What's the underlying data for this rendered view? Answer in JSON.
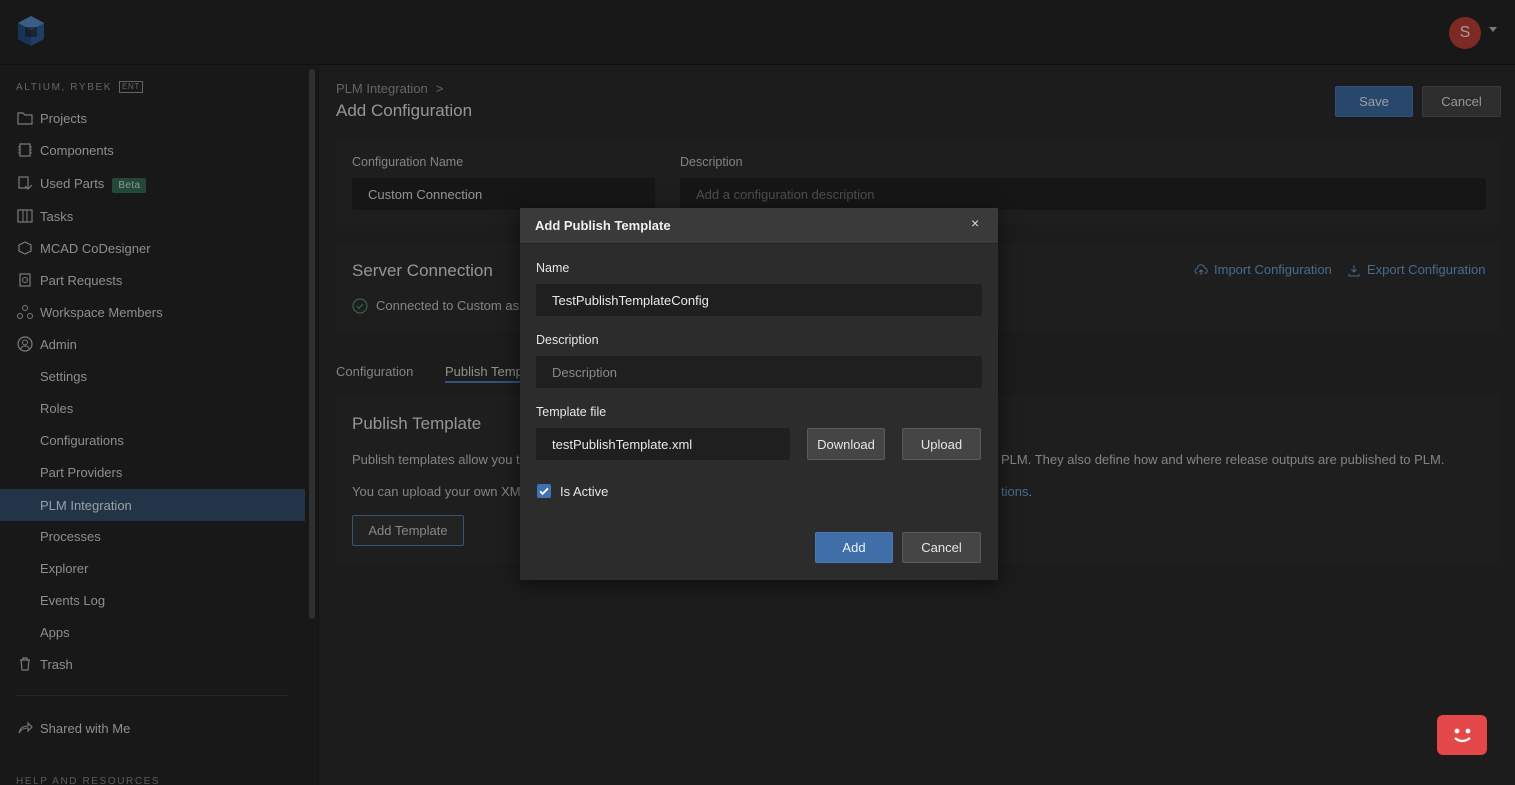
{
  "header": {
    "avatar_initial": "S"
  },
  "sidebar": {
    "workspace": "ALTIUM, RYBEK",
    "workspace_badge": "ENT",
    "items": [
      {
        "label": "Projects",
        "icon": "folder-icon"
      },
      {
        "label": "Components",
        "icon": "chip-icon"
      },
      {
        "label": "Used Parts",
        "icon": "used-parts-icon",
        "badge": "Beta"
      },
      {
        "label": "Tasks",
        "icon": "board-icon"
      },
      {
        "label": "MCAD CoDesigner",
        "icon": "cube-icon"
      },
      {
        "label": "Part Requests",
        "icon": "request-icon"
      },
      {
        "label": "Workspace Members",
        "icon": "members-icon"
      },
      {
        "label": "Admin",
        "icon": "user-circle-icon"
      },
      {
        "label": "Settings"
      },
      {
        "label": "Roles"
      },
      {
        "label": "Configurations"
      },
      {
        "label": "Part Providers"
      },
      {
        "label": "PLM Integration",
        "active": true
      },
      {
        "label": "Processes"
      },
      {
        "label": "Explorer"
      },
      {
        "label": "Events Log"
      },
      {
        "label": "Apps"
      },
      {
        "label": "Trash",
        "icon": "trash-icon"
      }
    ],
    "shared": {
      "label": "Shared with Me",
      "icon": "share-icon"
    },
    "help_heading": "HELP AND RESOURCES",
    "active_color": "#35506f"
  },
  "main": {
    "breadcrumb": "PLM Integration",
    "breadcrumb_sep": ">",
    "title": "Add Configuration",
    "save_label": "Save",
    "cancel_label": "Cancel",
    "config_name_label": "Configuration Name",
    "config_name_value": "Custom Connection",
    "description_label": "Description",
    "description_placeholder": "Add a configuration description",
    "server_title": "Server Connection",
    "server_status": "Connected to Custom as",
    "import_label": "Import Configuration",
    "export_label": "Export Configuration",
    "tabs": [
      "Configuration",
      "Publish Temp"
    ],
    "publish_title": "Publish Template",
    "publish_text_1a": "Publish templates allow you t",
    "publish_text_1b": "PLM. They also define how and where release outputs are published to PLM.",
    "publish_text_2a": "You can upload your own XMl",
    "publish_text_2b": "tions",
    "publish_text_2c": ".",
    "add_template_label": "Add Template"
  },
  "modal": {
    "title": "Add Publish Template",
    "close_glyph": "×",
    "name_label": "Name",
    "name_value": "TestPublishTemplateConfig",
    "description_label": "Description",
    "description_placeholder": "Description",
    "template_label": "Template file",
    "template_value": "testPublishTemplate.xml",
    "download_label": "Download",
    "upload_label": "Upload",
    "is_active_label": "Is Active",
    "is_active": true,
    "add_label": "Add",
    "cancel_label": "Cancel"
  },
  "colors": {
    "accent": "#3f6ea8",
    "link": "#6fa3d8",
    "avatar": "#c0413a",
    "feedback": "#e54848"
  }
}
